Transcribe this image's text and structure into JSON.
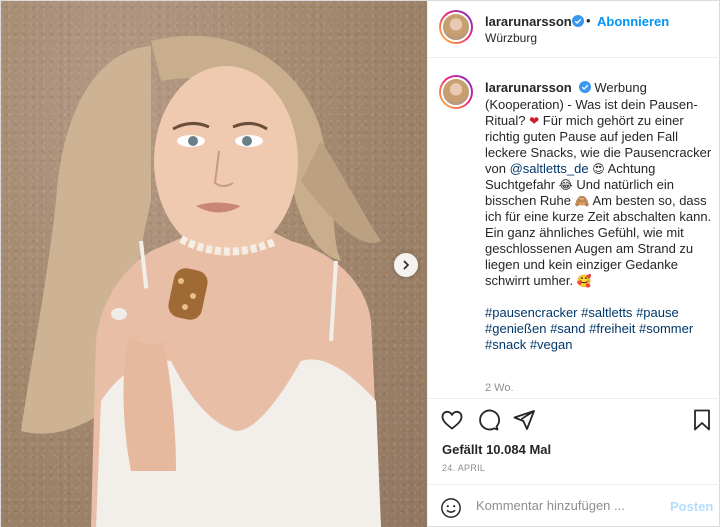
{
  "header": {
    "username": "lararunarsson",
    "separator": "•",
    "follow_label": "Abonnieren",
    "location": "Würzburg"
  },
  "caption": {
    "username": "lararunarsson",
    "part1": "Werbung (Kooperation) - Was ist dein Pausen-Ritual?",
    "emoji1": "❤",
    "part2": "Für mich gehört zu einer richtig guten Pause auf jeden Fall leckere Snacks, wie die Pausencracker von",
    "mention": "@saltletts_de",
    "emoji2": "😍",
    "part3": "Achtung Suchtgefahr",
    "emoji3": "😂",
    "part4": "Und natürlich ein bisschen Ruhe",
    "emoji4": "🙈",
    "part5": "Am besten so, dass ich für eine kurze Zeit abschalten kann. Ein ganz ähnliches Gefühl, wie mit geschlossenen Augen am Strand zu liegen und kein einziger Gedanke schwirrt umher.",
    "emoji5": "🥰",
    "hashtags": [
      "#pausencracker",
      "#saltletts",
      "#pause",
      "#genießen",
      "#sand",
      "#freiheit",
      "#sommer",
      "#snack",
      "#vegan"
    ],
    "age": "2 Wo."
  },
  "actions": {
    "like_icon": "heart-icon",
    "comment_icon": "comment-icon",
    "share_icon": "share-icon",
    "save_icon": "bookmark-icon"
  },
  "likes": "Gefällt 10.084 Mal",
  "date": "24. APRIL",
  "comment_box": {
    "placeholder": "Kommentar hinzufügen ...",
    "post_label": "Posten"
  },
  "colors": {
    "accent": "#0095f6",
    "link": "#00376b",
    "muted": "#8e8e8e",
    "post_disabled": "#b2dffc"
  }
}
